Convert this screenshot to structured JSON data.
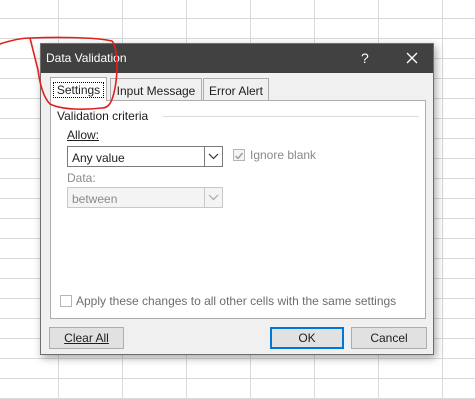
{
  "dialog": {
    "title": "Data Validation",
    "help_label": "?"
  },
  "tabs": [
    {
      "label": "Settings",
      "active": true
    },
    {
      "label": "Input Message",
      "active": false
    },
    {
      "label": "Error Alert",
      "active": false
    }
  ],
  "settings": {
    "section_title": "Validation criteria",
    "allow_label": "Allow:",
    "allow_value": "Any value",
    "ignore_blank_label": "Ignore blank",
    "ignore_blank_checked": true,
    "data_label": "Data:",
    "data_value": "between",
    "apply_all_label": "Apply these changes to all other cells with the same settings",
    "apply_all_checked": false
  },
  "buttons": {
    "clear_all": "Clear All",
    "ok": "OK",
    "cancel": "Cancel"
  },
  "icons": [
    "close-icon",
    "chevron-down-icon",
    "checkmark-icon"
  ],
  "colors": {
    "titlebar": "#414141",
    "dialog_bg": "#f0f0f0",
    "ok_border": "#0078d7",
    "annotation": "#e02020"
  }
}
